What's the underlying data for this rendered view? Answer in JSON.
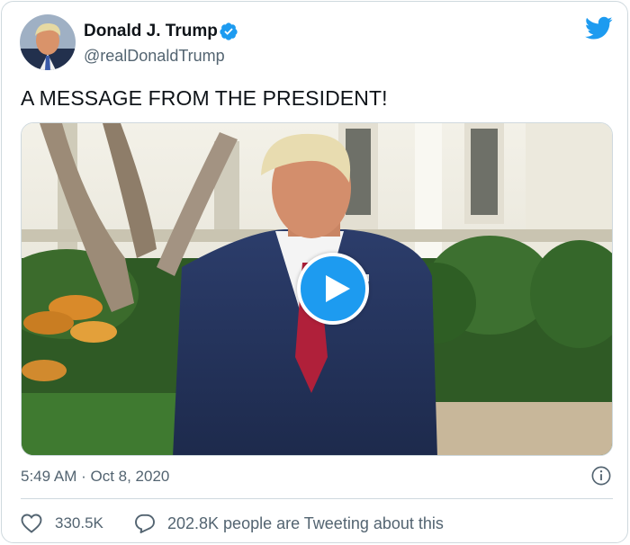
{
  "author": {
    "name": "Donald J. Trump",
    "handle": "@realDonaldTrump",
    "verified": true
  },
  "tweet": {
    "text": "A MESSAGE FROM THE PRESIDENT!",
    "timestamp": "5:49 AM · Oct 8, 2020"
  },
  "media": {
    "type": "video",
    "play_icon": "play-icon"
  },
  "actions": {
    "like_count": "330.5K",
    "reply_text": "202.8K people are Tweeting about this"
  },
  "icons": {
    "logo": "twitter-bird-icon",
    "verified": "verified-badge-icon",
    "info": "info-icon",
    "like": "heart-icon",
    "reply": "speech-bubble-icon"
  },
  "colors": {
    "brand_blue": "#1d9bf0",
    "text_primary": "#0f1419",
    "text_secondary": "#536471",
    "border": "#cfd9de"
  }
}
